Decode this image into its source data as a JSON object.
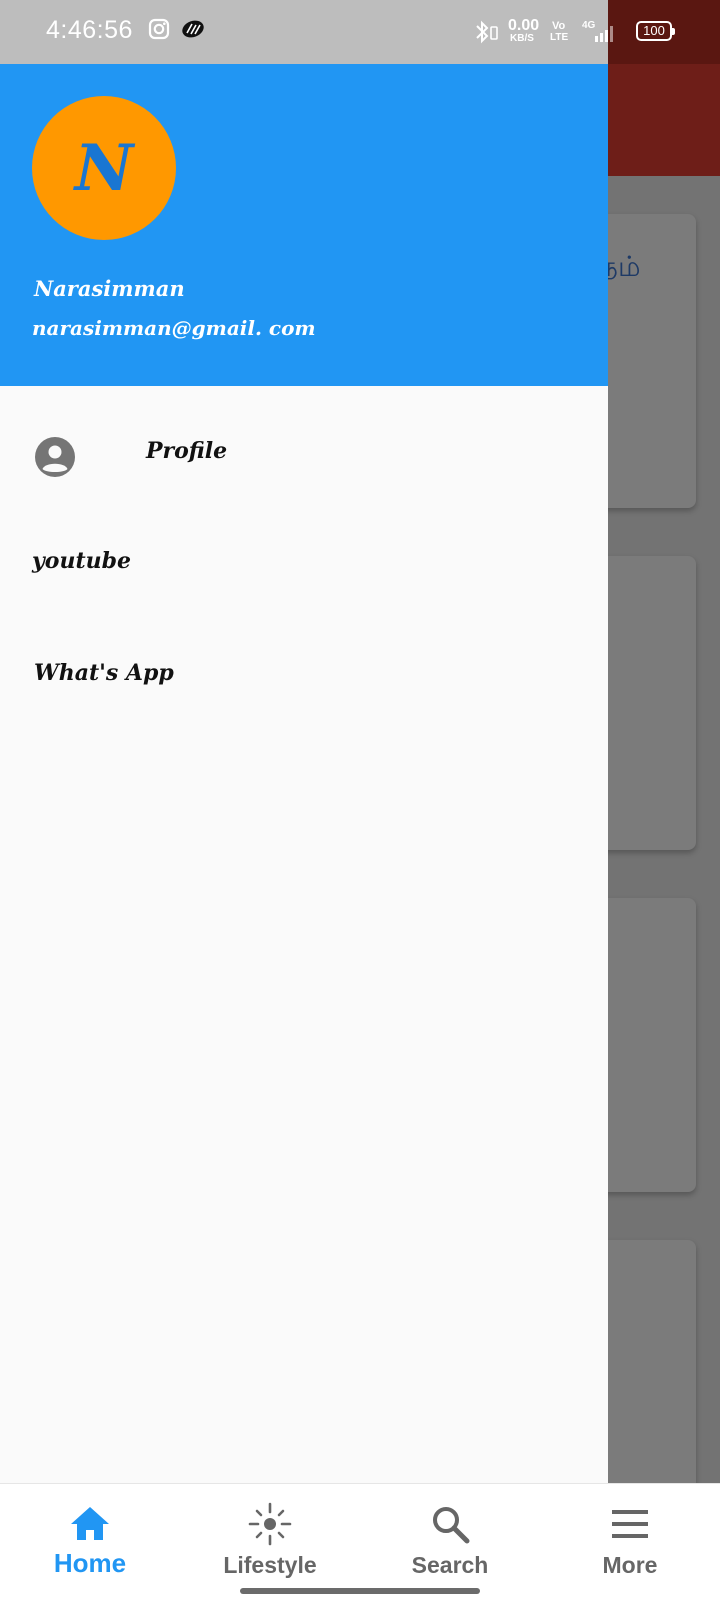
{
  "status_bar": {
    "time": "4:46:56",
    "net_speed_value": "0.00",
    "net_speed_unit": "KB/S",
    "volte_top": "Vo",
    "volte_bottom": "LTE",
    "signal_label": "4G",
    "battery": "100"
  },
  "background": {
    "card_text": "நம்"
  },
  "drawer": {
    "avatar_letter": "N",
    "user_name": "Narasimman",
    "user_email": "narasimman@gmail. com",
    "items": [
      {
        "label": "Profile",
        "icon": "account-circle-icon"
      },
      {
        "label": "youtube"
      },
      {
        "label": "What's App"
      }
    ]
  },
  "bottom_nav": {
    "active_color": "#2196f3",
    "items": [
      {
        "label": "Home",
        "icon": "home-icon",
        "active": true
      },
      {
        "label": "Lifestyle",
        "icon": "lifestyle-sun-icon",
        "active": false
      },
      {
        "label": "Search",
        "icon": "search-icon",
        "active": false
      },
      {
        "label": "More",
        "icon": "menu-icon",
        "active": false
      }
    ]
  }
}
